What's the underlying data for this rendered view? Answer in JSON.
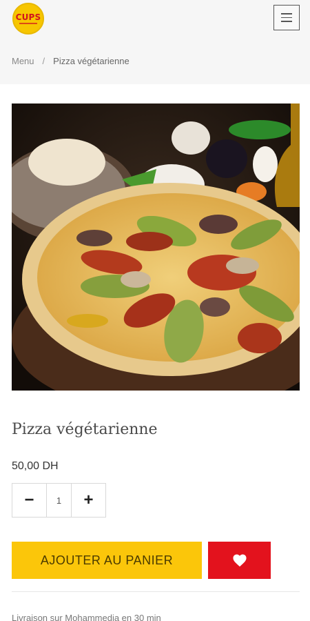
{
  "header": {
    "logo_text": "CUPS",
    "menu_icon": "hamburger-icon"
  },
  "breadcrumb": {
    "home": "Menu",
    "separator": "/",
    "current": "Pizza végétarienne"
  },
  "product": {
    "image_alt": "Pizza végétarienne",
    "title": "Pizza végétarienne",
    "price": "50,00 DH",
    "quantity": "1"
  },
  "quantity_controls": {
    "decrement": "−",
    "increment": "+"
  },
  "actions": {
    "add_to_cart": "AJOUTER AU PANIER",
    "wishlist_icon": "heart-icon"
  },
  "delivery_note": "Livraison sur Mohammedia en 30 min",
  "colors": {
    "brand_yellow": "#fbc60a",
    "brand_red": "#e3121d",
    "header_bg": "#f6f6f6"
  }
}
